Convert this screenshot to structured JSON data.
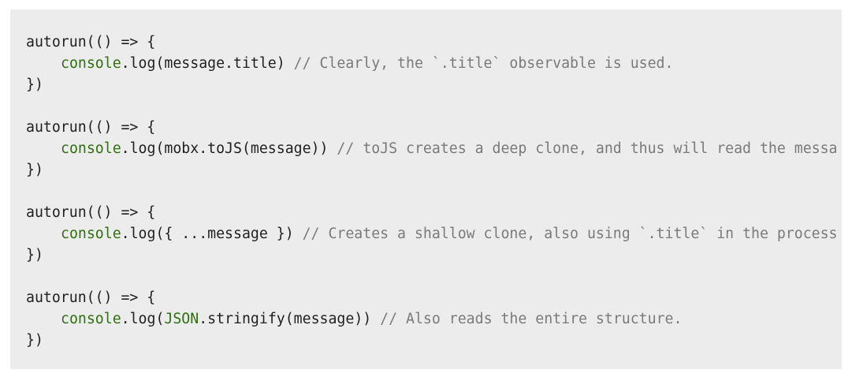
{
  "code_block": {
    "lines": [
      [
        {
          "t": "plain",
          "v": "autorun(() => {"
        }
      ],
      [
        {
          "t": "indent"
        },
        {
          "t": "builtin",
          "v": "console"
        },
        {
          "t": "plain",
          "v": ".log(message.title) "
        },
        {
          "t": "comment",
          "v": "// Clearly, the `.title` observable is used."
        }
      ],
      [
        {
          "t": "plain",
          "v": "})"
        }
      ],
      [],
      [
        {
          "t": "plain",
          "v": "autorun(() => {"
        }
      ],
      [
        {
          "t": "indent"
        },
        {
          "t": "builtin",
          "v": "console"
        },
        {
          "t": "plain",
          "v": ".log(mobx.toJS(message)) "
        },
        {
          "t": "comment",
          "v": "// toJS creates a deep clone, and thus will read the messa"
        }
      ],
      [
        {
          "t": "plain",
          "v": "})"
        }
      ],
      [],
      [
        {
          "t": "plain",
          "v": "autorun(() => {"
        }
      ],
      [
        {
          "t": "indent"
        },
        {
          "t": "builtin",
          "v": "console"
        },
        {
          "t": "plain",
          "v": ".log({ ...message }) "
        },
        {
          "t": "comment",
          "v": "// Creates a shallow clone, also using `.title` in the process"
        }
      ],
      [
        {
          "t": "plain",
          "v": "})"
        }
      ],
      [],
      [
        {
          "t": "plain",
          "v": "autorun(() => {"
        }
      ],
      [
        {
          "t": "indent"
        },
        {
          "t": "builtin",
          "v": "console"
        },
        {
          "t": "plain",
          "v": ".log("
        },
        {
          "t": "builtin",
          "v": "JSON"
        },
        {
          "t": "plain",
          "v": ".stringify(message)) "
        },
        {
          "t": "comment",
          "v": "// Also reads the entire structure."
        }
      ],
      [
        {
          "t": "plain",
          "v": "})"
        }
      ]
    ]
  },
  "colors": {
    "background": "#ececec",
    "builtin": "#2f6f0f",
    "comment": "#7a7a7a",
    "text": "#1f1f1f"
  }
}
